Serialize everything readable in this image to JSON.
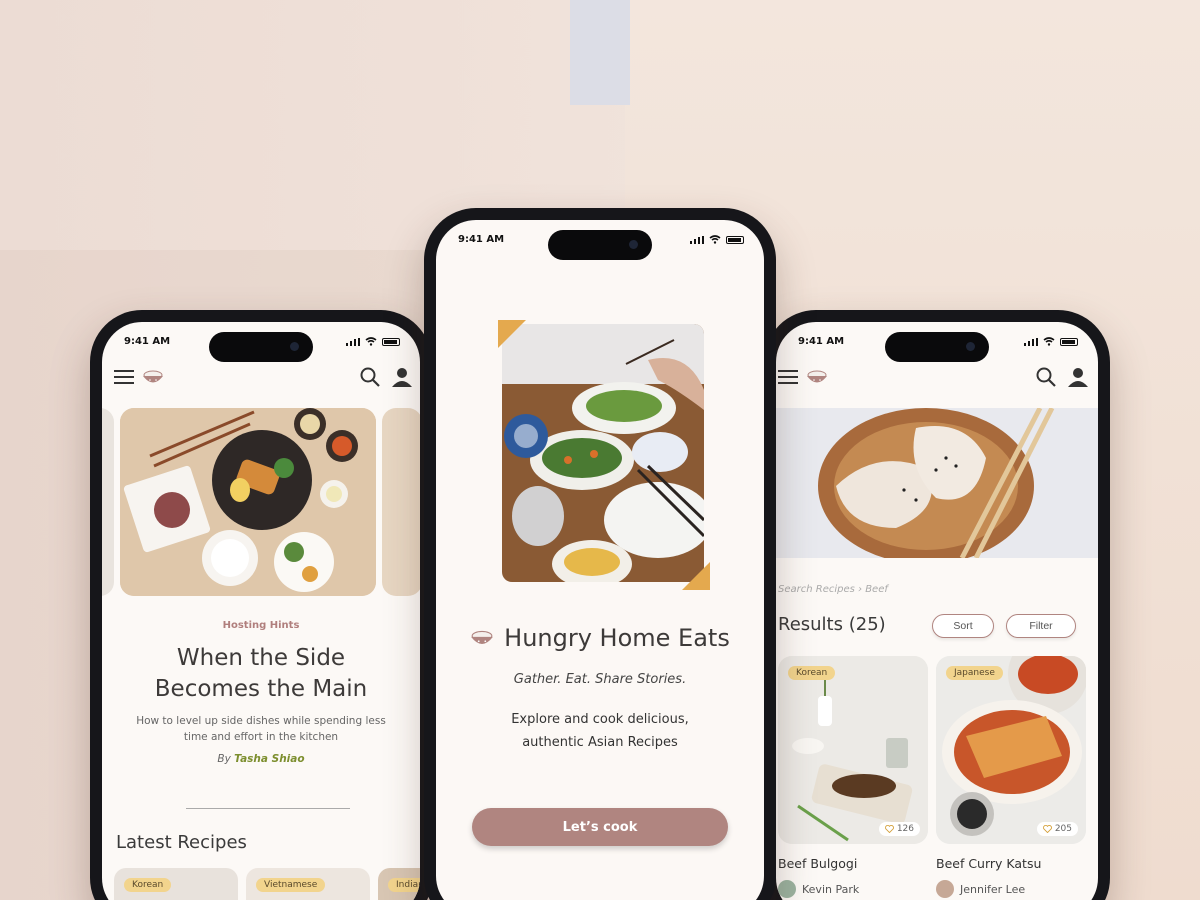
{
  "status": {
    "time": "9:41 AM"
  },
  "left": {
    "eyebrow": "Hosting Hints",
    "headline_1": "When the Side",
    "headline_2": "Becomes the Main",
    "dek_1": "How to level up side dishes while spending less",
    "dek_2": "time and effort in the kitchen",
    "byline_prefix": "By",
    "author": "Tasha Shiao",
    "section": "Latest Recipes",
    "tags": [
      "Korean",
      "Vietnamese",
      "Indian"
    ]
  },
  "center": {
    "brand": "Hungry Home Eats",
    "tagline": "Gather. Eat. Share Stories.",
    "blurb_1": "Explore and cook delicious,",
    "blurb_2": "authentic Asian Recipes",
    "cta": "Let’s cook"
  },
  "right": {
    "breadcrumb": "Search Recipes › Beef",
    "results": "Results (25)",
    "sort": "Sort",
    "filter": "Filter",
    "cards": [
      {
        "tag": "Korean",
        "likes": "126",
        "title": "Beef Bulgogi",
        "author": "Kevin Park"
      },
      {
        "tag": "Japanese",
        "likes": "205",
        "title": "Beef Curry Katsu",
        "author": "Jennifer Lee"
      }
    ]
  },
  "colors": {
    "accent": "#b08580",
    "tag": "#f2d48d",
    "byline": "#7d8f2f",
    "background": "#fcf8f5"
  },
  "icons": [
    "menu-icon",
    "bowl-logo-icon",
    "search-icon",
    "user-icon",
    "heart-icon",
    "signal-icon",
    "wifi-icon",
    "battery-icon"
  ]
}
